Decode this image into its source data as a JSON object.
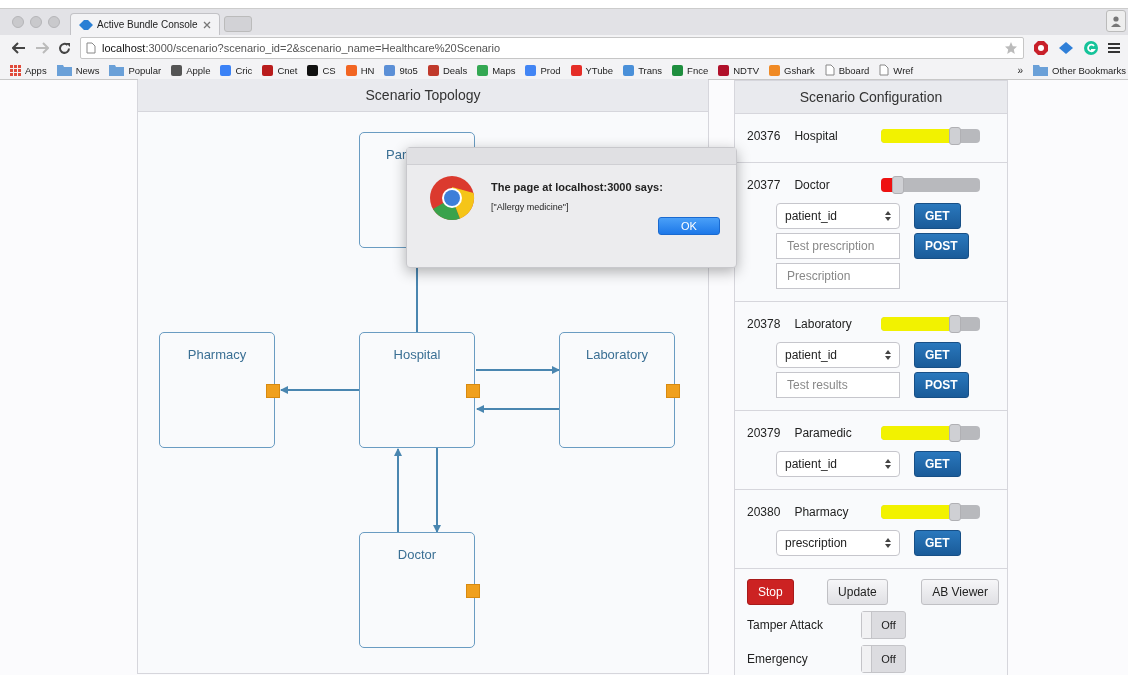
{
  "browser": {
    "tab_title": "Active Bundle Console",
    "url_host": "localhost",
    "url_rest": ":3000/scenario?scenario_id=2&scenario_name=Healthcare%20Scenario",
    "bookmarks": [
      {
        "label": "Apps",
        "kind": "apps",
        "color": "#e04a3a"
      },
      {
        "label": "News",
        "kind": "folder",
        "color": "#6aa0d8"
      },
      {
        "label": "Popular",
        "kind": "folder",
        "color": "#6aa0d8"
      },
      {
        "label": "Apple",
        "kind": "site",
        "color": "#555555"
      },
      {
        "label": "Cric",
        "kind": "site",
        "color": "#3b82f6"
      },
      {
        "label": "Cnet",
        "kind": "site",
        "color": "#b91c1c"
      },
      {
        "label": "CS",
        "kind": "site",
        "color": "#111111"
      },
      {
        "label": "HN",
        "kind": "site",
        "color": "#f26522"
      },
      {
        "label": "9to5",
        "kind": "site",
        "color": "#5b8fd6"
      },
      {
        "label": "Deals",
        "kind": "site",
        "color": "#c0392b"
      },
      {
        "label": "Maps",
        "kind": "site",
        "color": "#34a853"
      },
      {
        "label": "Prod",
        "kind": "site",
        "color": "#4285f4"
      },
      {
        "label": "YTube",
        "kind": "site",
        "color": "#e52d27"
      },
      {
        "label": "Trans",
        "kind": "site",
        "color": "#4a90d9"
      },
      {
        "label": "Fnce",
        "kind": "site",
        "color": "#1e8e3e"
      },
      {
        "label": "NDTV",
        "kind": "site",
        "color": "#b0102a"
      },
      {
        "label": "Gshark",
        "kind": "site",
        "color": "#f08a24"
      },
      {
        "label": "Bboard",
        "kind": "page",
        "color": "#ffffff"
      },
      {
        "label": "Wref",
        "kind": "page",
        "color": "#ffffff"
      }
    ],
    "more": "»",
    "other": "Other Bookmarks"
  },
  "topology": {
    "title": "Scenario Topology",
    "nodes": [
      {
        "label": "Par"
      },
      {
        "label": "Pharmacy"
      },
      {
        "label": "Hospital"
      },
      {
        "label": "Laboratory"
      },
      {
        "label": "Doctor"
      }
    ]
  },
  "configuration": {
    "title": "Scenario Configuration",
    "agents": [
      {
        "id": "20376",
        "name": "Hospital",
        "level": 0.75,
        "color": "#f2f200"
      },
      {
        "id": "20377",
        "name": "Doctor",
        "level": 0.17,
        "color": "#ee1111",
        "controls": [
          {
            "kind": "select",
            "text": "patient_id",
            "button": "GET"
          },
          {
            "kind": "input",
            "placeholder": "Test prescription",
            "button": "POST"
          },
          {
            "kind": "input",
            "placeholder": "Prescription"
          }
        ]
      },
      {
        "id": "20378",
        "name": "Laboratory",
        "level": 0.75,
        "color": "#f2f200",
        "controls": [
          {
            "kind": "select",
            "text": "patient_id",
            "button": "GET"
          },
          {
            "kind": "input",
            "placeholder": "Test results",
            "button": "POST"
          }
        ]
      },
      {
        "id": "20379",
        "name": "Paramedic",
        "level": 0.75,
        "color": "#f2f200",
        "controls": [
          {
            "kind": "select",
            "text": "patient_id",
            "button": "GET"
          }
        ]
      },
      {
        "id": "20380",
        "name": "Pharmacy",
        "level": 0.75,
        "color": "#f2f200",
        "controls": [
          {
            "kind": "select",
            "text": "prescription",
            "button": "GET"
          }
        ]
      }
    ],
    "buttons": [
      {
        "label": "Stop",
        "kind": "danger"
      },
      {
        "label": "Update",
        "kind": "default"
      },
      {
        "label": "AB Viewer",
        "kind": "default"
      }
    ],
    "toggles": [
      {
        "label": "Tamper Attack",
        "on": false,
        "text": "Off"
      },
      {
        "label": "Emergency",
        "on": false,
        "text": "Off"
      }
    ]
  },
  "dialog": {
    "title": "The page at localhost:3000 says:",
    "message": "[\"Allergy medicine\"]",
    "ok": "OK"
  }
}
